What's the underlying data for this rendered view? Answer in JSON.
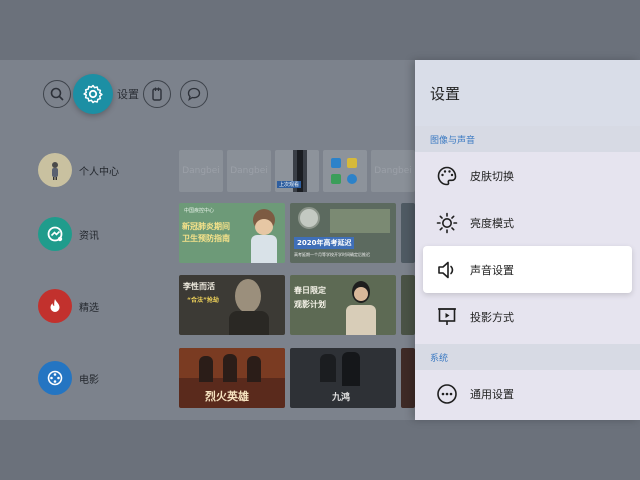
{
  "topbar": {
    "settings_label": "设置",
    "icons": [
      "search-icon",
      "gear-icon",
      "input-source-icon",
      "message-icon"
    ]
  },
  "left_nav": [
    {
      "label": "个人中心",
      "icon": "user-avatar",
      "color": "#c9c1a0"
    },
    {
      "label": "资讯",
      "icon": "news-icon",
      "color": "#1f9c8c"
    },
    {
      "label": "精选",
      "icon": "flame-icon",
      "color": "#c2312d"
    },
    {
      "label": "电影",
      "icon": "film-reel-icon",
      "color": "#2475c2"
    }
  ],
  "row1_tiles": [
    "Dangbei",
    "Dangbei",
    "",
    "",
    "Dangbei"
  ],
  "row1_subtile_text": "上次观看",
  "news_tiles": {
    "tile1_header": "中国疾控中心",
    "tile1_title_line1": "新冠肺炎期间",
    "tile1_title_line2": "卫生预防指南",
    "tile2_banner": "2020年高考延迟",
    "tile2_subtitle": "高考延期一个月等学校开学时间确定后推迟"
  },
  "featured_tiles": {
    "tile1_title": "李性而活",
    "tile1_sub": "“合法”抢劫",
    "tile2_title_line1": "春日限定",
    "tile2_title_line2": "观影计划"
  },
  "movie_tiles": {
    "tile1_title": "烈火英雄",
    "tile2_title": "九鸿"
  },
  "panel": {
    "title": "设置",
    "section1": "图像与声音",
    "section2": "系统",
    "items": [
      {
        "label": "皮肤切换",
        "icon": "palette-icon",
        "active": false
      },
      {
        "label": "亮度模式",
        "icon": "sun-icon",
        "active": false
      },
      {
        "label": "声音设置",
        "icon": "speaker-icon",
        "active": true
      },
      {
        "label": "投影方式",
        "icon": "projector-icon",
        "active": false
      },
      {
        "label": "通用设置",
        "icon": "more-dots-icon",
        "active": false
      }
    ]
  }
}
